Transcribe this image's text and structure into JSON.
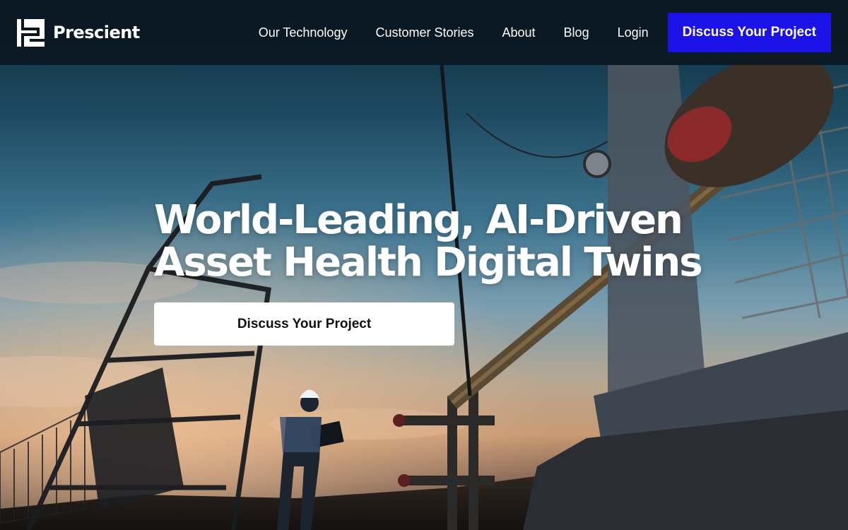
{
  "header": {
    "logo_text": "Prescient",
    "nav": {
      "items": [
        "Our Technology",
        "Customer Stories",
        "About",
        "Blog",
        "Login"
      ],
      "cta_label": "Discuss Your Project"
    }
  },
  "hero": {
    "title_line1": "World-Leading, AI-Driven",
    "title_line2": "Asset Health Digital Twins",
    "cta_label": "Discuss Your Project"
  },
  "colors": {
    "primary_cta": "#1a12e6",
    "header_bg": "#0a1620",
    "hero_text": "#ffffff"
  },
  "background": {
    "image_subject": "oil pumpjacks silhouetted at sunset with worker in hard hat holding tablet"
  }
}
